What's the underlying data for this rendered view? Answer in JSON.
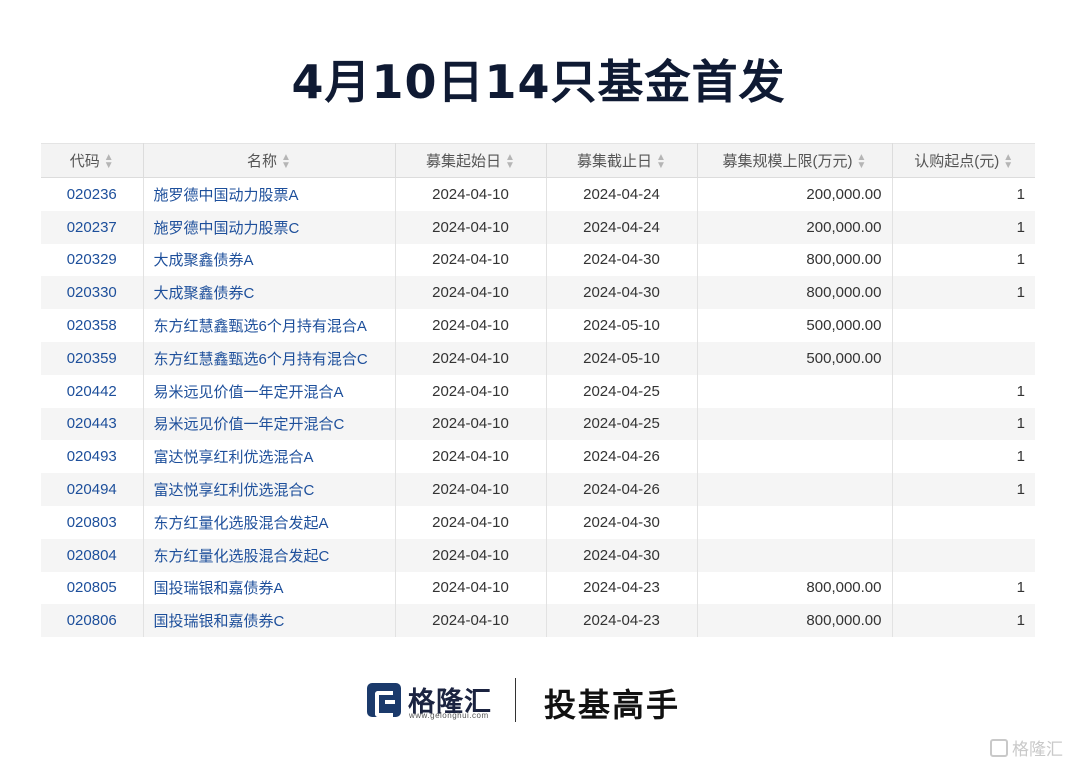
{
  "title": "4月10日14只基金首发",
  "table": {
    "headers": [
      "代码",
      "名称",
      "募集起始日",
      "募集截止日",
      "募集规模上限(万元)",
      "认购起点(元)"
    ],
    "rows": [
      [
        "020236",
        "施罗德中国动力股票A",
        "2024-04-10",
        "2024-04-24",
        "200,000.00",
        "1"
      ],
      [
        "020237",
        "施罗德中国动力股票C",
        "2024-04-10",
        "2024-04-24",
        "200,000.00",
        "1"
      ],
      [
        "020329",
        "大成聚鑫债券A",
        "2024-04-10",
        "2024-04-30",
        "800,000.00",
        "1"
      ],
      [
        "020330",
        "大成聚鑫债券C",
        "2024-04-10",
        "2024-04-30",
        "800,000.00",
        "1"
      ],
      [
        "020358",
        "东方红慧鑫甄选6个月持有混合A",
        "2024-04-10",
        "2024-05-10",
        "500,000.00",
        ""
      ],
      [
        "020359",
        "东方红慧鑫甄选6个月持有混合C",
        "2024-04-10",
        "2024-05-10",
        "500,000.00",
        ""
      ],
      [
        "020442",
        "易米远见价值一年定开混合A",
        "2024-04-10",
        "2024-04-25",
        "",
        "1"
      ],
      [
        "020443",
        "易米远见价值一年定开混合C",
        "2024-04-10",
        "2024-04-25",
        "",
        "1"
      ],
      [
        "020493",
        "富达悦享红利优选混合A",
        "2024-04-10",
        "2024-04-26",
        "",
        "1"
      ],
      [
        "020494",
        "富达悦享红利优选混合C",
        "2024-04-10",
        "2024-04-26",
        "",
        "1"
      ],
      [
        "020803",
        "东方红量化选股混合发起A",
        "2024-04-10",
        "2024-04-30",
        "",
        ""
      ],
      [
        "020804",
        "东方红量化选股混合发起C",
        "2024-04-10",
        "2024-04-30",
        "",
        ""
      ],
      [
        "020805",
        "国投瑞银和嘉债券A",
        "2024-04-10",
        "2024-04-23",
        "800,000.00",
        "1"
      ],
      [
        "020806",
        "国投瑞银和嘉债券C",
        "2024-04-10",
        "2024-04-23",
        "800,000.00",
        "1"
      ]
    ]
  },
  "footer": {
    "logo_text": "格隆汇",
    "logo_url": "www.gelonghui.com",
    "slogan": "投基高手"
  },
  "watermark": "格隆汇",
  "colors": {
    "title": "#0f1a33",
    "link": "#1d4f9b",
    "brand": "#1b3a6b"
  }
}
